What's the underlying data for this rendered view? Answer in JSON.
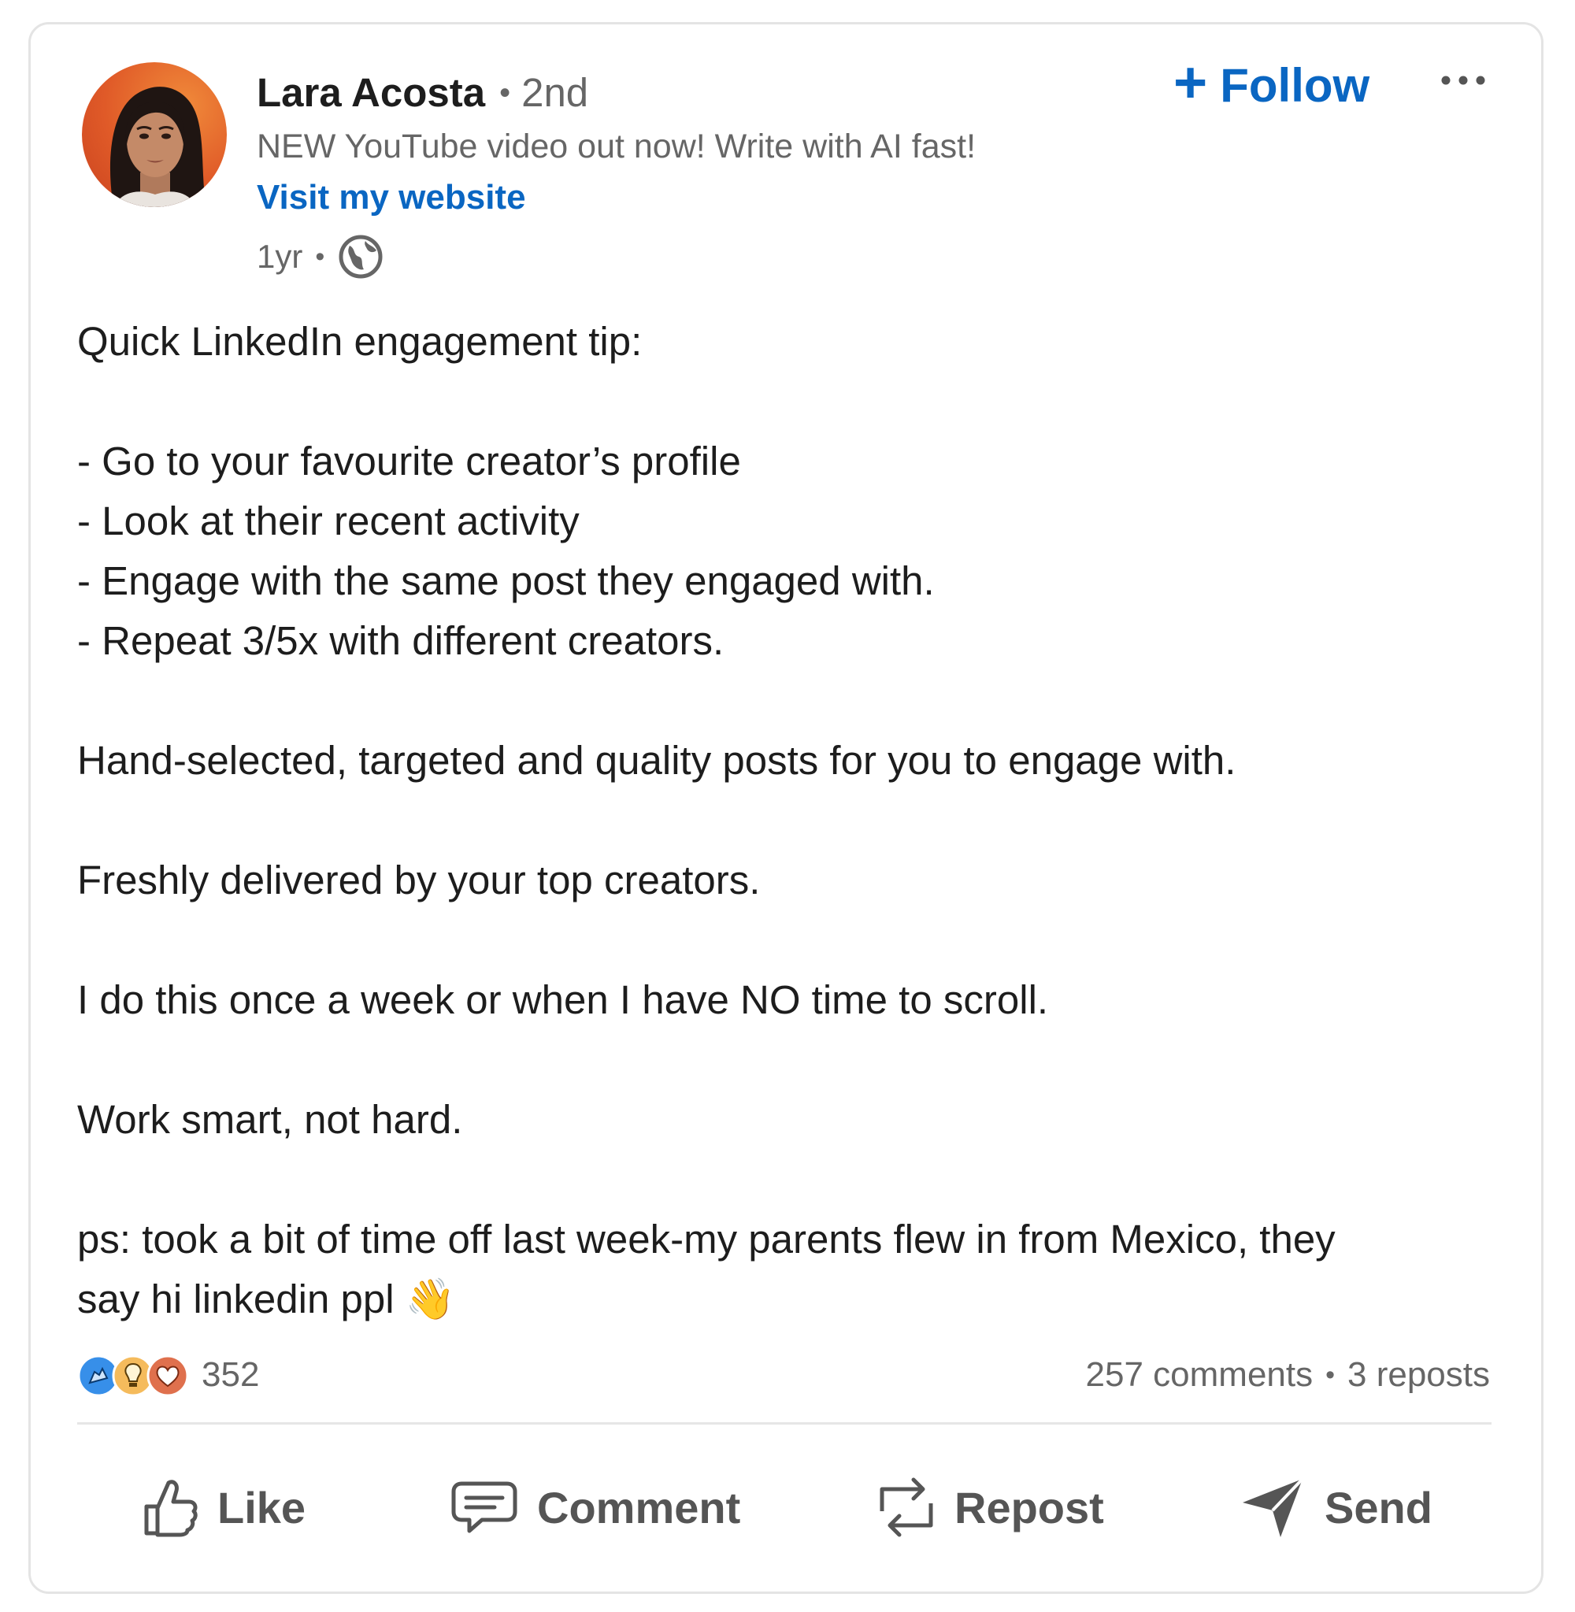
{
  "author": {
    "name": "Lara Acosta",
    "degree": "2nd",
    "headline": "NEW YouTube video out now! Write with AI fast!",
    "website_link": "Visit my website",
    "time_ago": "1yr",
    "visibility_icon": "globe-icon"
  },
  "header_actions": {
    "follow_label": "Follow",
    "follow_icon": "plus-icon",
    "more_icon": "more-options-icon"
  },
  "post": {
    "lines": [
      "Quick LinkedIn engagement tip:",
      "",
      "- Go to your favourite creator’s profile",
      "- Look at their recent activity",
      "- Engage with the same post they engaged with.",
      "- Repeat 3/5x with different creators.",
      "",
      "Hand-selected, targeted and quality posts for you to engage with.",
      "",
      "Freshly delivered by your top creators.",
      "",
      "I do this once a week or when I have NO time to scroll.",
      "",
      "Work smart, not hard.",
      "",
      "ps: took a bit of time off last week-my parents flew in from Mexico, they",
      "say hi linkedin ppl 👋"
    ]
  },
  "social": {
    "reaction_icons": [
      "celebrate-icon",
      "insightful-icon",
      "love-icon"
    ],
    "reaction_count": "352",
    "comments": "257 comments",
    "reposts": "3 reposts"
  },
  "actions": [
    {
      "label": "Like",
      "icon": "like-icon"
    },
    {
      "label": "Comment",
      "icon": "comment-icon"
    },
    {
      "label": "Repost",
      "icon": "repost-icon"
    },
    {
      "label": "Send",
      "icon": "send-icon"
    }
  ],
  "colors": {
    "accent": "#0a66c2",
    "muted_text": "#666666",
    "body_text": "#1d1d1d",
    "border": "#e4e4e4"
  }
}
